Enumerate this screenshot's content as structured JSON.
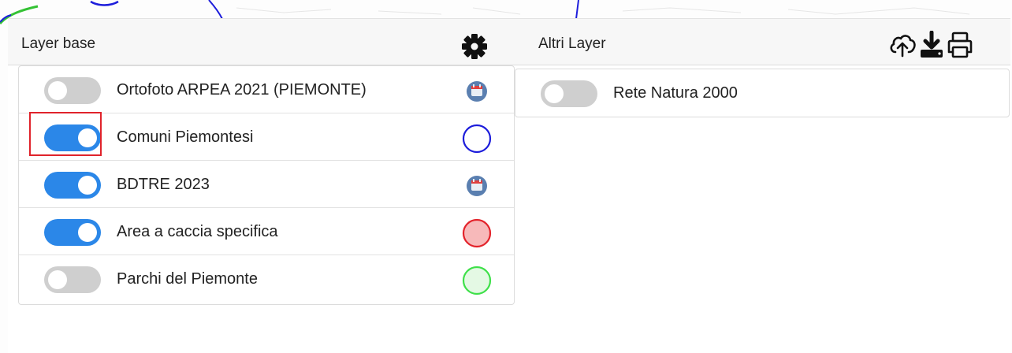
{
  "layer_base": {
    "title": "Layer base",
    "settings_icon": "gear-icon",
    "items": [
      {
        "label": "Ortofoto ARPEA 2021 (PIEMONTE)",
        "on": false,
        "legend": "calendar-icon"
      },
      {
        "label": "Comuni Piemontesi",
        "on": true,
        "legend": "blue-outline-circle",
        "highlighted": true
      },
      {
        "label": "BDTRE 2023",
        "on": true,
        "legend": "calendar-icon"
      },
      {
        "label": "Area a caccia specifica",
        "on": true,
        "legend": "red-filled-circle"
      },
      {
        "label": "Parchi del Piemonte",
        "on": false,
        "legend": "green-filled-circle"
      }
    ]
  },
  "altri_layer": {
    "title": "Altri Layer",
    "header_icons": [
      "cloud-upload-icon",
      "download-icon",
      "print-icon"
    ],
    "items": [
      {
        "label": "Rete Natura 2000",
        "on": false
      }
    ]
  },
  "colors": {
    "toggle_on": "#2b87e8",
    "toggle_off": "#cfcfcf",
    "highlight": "#e0232b",
    "legend_blue": "#1d1ddb",
    "legend_red_stroke": "#e3232b",
    "legend_red_fill": "#f7b9ba",
    "legend_green_stroke": "#3fe04a",
    "legend_green_fill": "#e4f9e4",
    "calendar_bg": "#5a7fb0"
  }
}
